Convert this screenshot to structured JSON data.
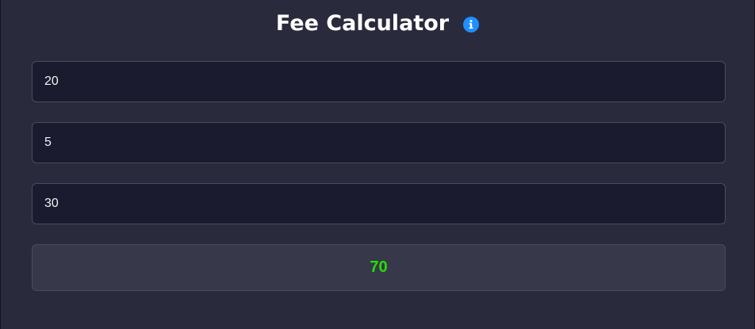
{
  "header": {
    "title": "Fee Calculator",
    "info_icon": "info-icon"
  },
  "inputs": [
    {
      "value": "20"
    },
    {
      "value": "5"
    },
    {
      "value": "30"
    }
  ],
  "result": {
    "value": "70"
  },
  "colors": {
    "background": "#2a2a3d",
    "input_background": "#1a1b2e",
    "result_background": "#37384a",
    "border": "#4a4b5e",
    "title": "#ffffff",
    "info_icon": "#1e90ff",
    "result_text": "#22e000"
  }
}
